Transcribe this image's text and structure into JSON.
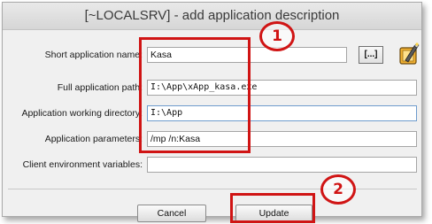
{
  "window": {
    "title": "[~LOCALSRV] - add application description"
  },
  "form": {
    "short_name": {
      "label": "Short application name:",
      "value": "Kasa"
    },
    "full_path": {
      "label": "Full application path:",
      "value": "I:\\App\\xApp_kasa.exe"
    },
    "working_dir": {
      "label": "Application working directory:",
      "value": "I:\\App"
    },
    "parameters": {
      "label": "Application parameters:",
      "value": "/mp /n:Kasa"
    },
    "env_vars": {
      "label": "Client environment variables:",
      "value": ""
    }
  },
  "browse": {
    "label": "[...]"
  },
  "icons": {
    "app": "application-wizard-icon"
  },
  "buttons": {
    "cancel": "Cancel",
    "update": "Update"
  },
  "annotations": {
    "callout1": "1",
    "callout2": "2",
    "color": "#d01414"
  }
}
